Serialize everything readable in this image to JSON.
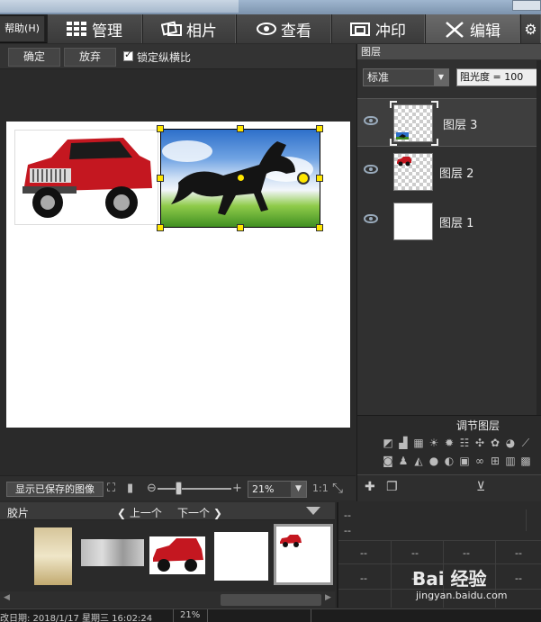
{
  "menu": {
    "help": "帮助(H)"
  },
  "tabs": [
    {
      "label": "管理",
      "icon": "grid-icon"
    },
    {
      "label": "相片",
      "icon": "photos-icon"
    },
    {
      "label": "查看",
      "icon": "eye-icon"
    },
    {
      "label": "冲印",
      "icon": "print-icon"
    },
    {
      "label": "编辑",
      "icon": "edit-tools-icon",
      "active": true
    }
  ],
  "toolbar": {
    "confirm": "确定",
    "discard": "放弃",
    "lock_ratio": "锁定纵横比",
    "lock_ratio_checked": true
  },
  "zoombar": {
    "show_saved": "显示已保存的图像",
    "zoom_value": "21%",
    "ratio": "1:1"
  },
  "filmstrip": {
    "title": "胶片",
    "prev": "上一个",
    "next": "下一个"
  },
  "info_panel": {
    "cells": [
      "--",
      "--",
      "--",
      "--",
      "--",
      "--",
      "--",
      "--",
      "--",
      "--"
    ]
  },
  "status": {
    "date": "改日期: 2018/1/17 星期三 16:02:24",
    "zoom": "21%"
  },
  "layers_panel": {
    "title": "图层",
    "blend_mode": "标准",
    "opacity": "阻光度 = 100",
    "layers": [
      {
        "name": "图层 3",
        "active": true
      },
      {
        "name": "图层 2",
        "active": false
      },
      {
        "name": "图层 1",
        "active": false
      }
    ],
    "adjust_title": "调节图层"
  },
  "watermark": {
    "brand": "Bai 经验",
    "url": "jingyan.baidu.com"
  },
  "colors": {
    "accent_yellow": "#ffe600",
    "panel_bg": "#303030"
  }
}
